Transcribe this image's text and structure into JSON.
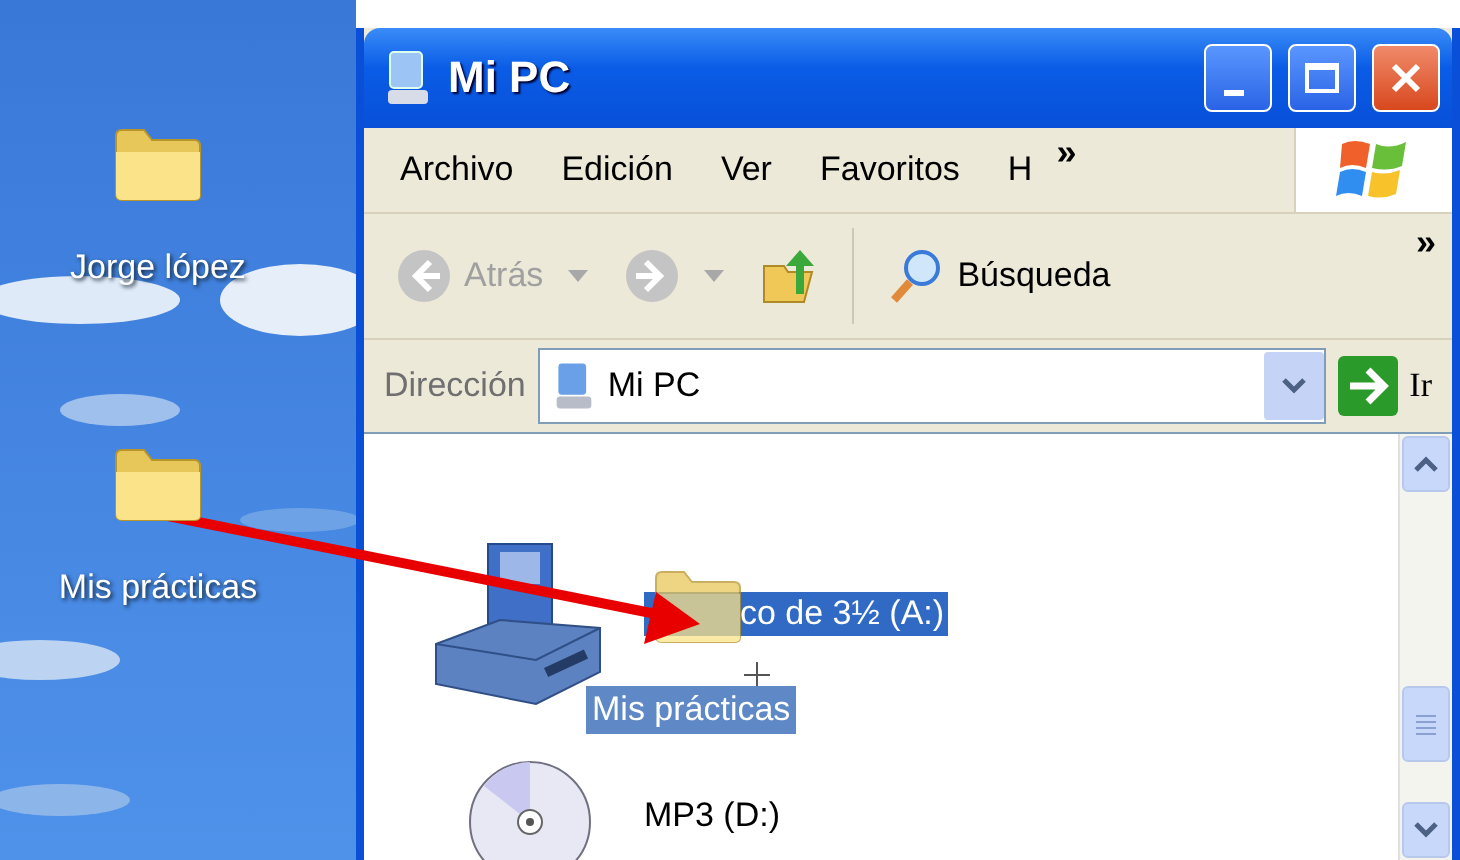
{
  "desktop": {
    "icons": [
      {
        "label": "Jorge lópez"
      },
      {
        "label": "Mis prácticas"
      }
    ]
  },
  "window": {
    "title": "Mi PC",
    "menu": [
      {
        "label": "Archivo"
      },
      {
        "label": "Edición"
      },
      {
        "label": "Ver"
      },
      {
        "label": "Favoritos"
      },
      {
        "label": "H"
      }
    ],
    "menu_more": "»",
    "toolbar": {
      "back": {
        "label": "Atrás",
        "disabled": true
      },
      "forward": {
        "disabled": true
      },
      "search": "Búsqueda",
      "more": "»"
    },
    "address": {
      "label": "Dirección",
      "value": "Mi PC",
      "go": "Ir"
    },
    "items": [
      {
        "kind": "floppy",
        "label": "co de 3½ (A:)",
        "selected": true
      },
      {
        "kind": "cd",
        "label": "MP3 (D:)",
        "selected": false
      }
    ]
  },
  "drag": {
    "label": "Mis prácticas"
  }
}
